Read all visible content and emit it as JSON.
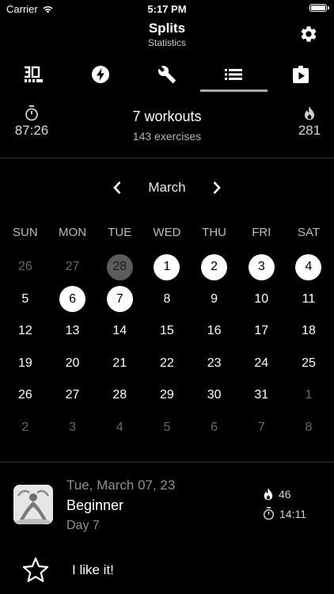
{
  "status_bar": {
    "carrier": "Carrier",
    "time": "5:17 PM"
  },
  "nav": {
    "title": "Splits",
    "subtitle": "Statistics"
  },
  "tabs": [
    {
      "icon": "timer-30-icon"
    },
    {
      "icon": "lightning-icon"
    },
    {
      "icon": "wrench-icon"
    },
    {
      "icon": "list-icon",
      "active": true
    },
    {
      "icon": "clipboard-play-icon"
    }
  ],
  "summary": {
    "duration": "87:26",
    "workouts": "7 workouts",
    "exercises": "143 exercises",
    "calories": "281"
  },
  "calendar": {
    "month": "March",
    "weekdays": [
      "SUN",
      "MON",
      "TUE",
      "WED",
      "THU",
      "FRI",
      "SAT"
    ],
    "days": [
      {
        "n": "26",
        "s": "muted"
      },
      {
        "n": "27",
        "s": "muted"
      },
      {
        "n": "28",
        "s": "gray"
      },
      {
        "n": "1",
        "s": "done"
      },
      {
        "n": "2",
        "s": "done"
      },
      {
        "n": "3",
        "s": "done"
      },
      {
        "n": "4",
        "s": "done"
      },
      {
        "n": "5",
        "s": ""
      },
      {
        "n": "6",
        "s": "done"
      },
      {
        "n": "7",
        "s": "done"
      },
      {
        "n": "8",
        "s": ""
      },
      {
        "n": "9",
        "s": ""
      },
      {
        "n": "10",
        "s": ""
      },
      {
        "n": "11",
        "s": ""
      },
      {
        "n": "12",
        "s": ""
      },
      {
        "n": "13",
        "s": ""
      },
      {
        "n": "14",
        "s": ""
      },
      {
        "n": "15",
        "s": ""
      },
      {
        "n": "16",
        "s": ""
      },
      {
        "n": "17",
        "s": ""
      },
      {
        "n": "18",
        "s": ""
      },
      {
        "n": "19",
        "s": ""
      },
      {
        "n": "20",
        "s": ""
      },
      {
        "n": "21",
        "s": ""
      },
      {
        "n": "22",
        "s": ""
      },
      {
        "n": "23",
        "s": ""
      },
      {
        "n": "24",
        "s": ""
      },
      {
        "n": "25",
        "s": ""
      },
      {
        "n": "26",
        "s": ""
      },
      {
        "n": "27",
        "s": ""
      },
      {
        "n": "28",
        "s": ""
      },
      {
        "n": "29",
        "s": ""
      },
      {
        "n": "30",
        "s": ""
      },
      {
        "n": "31",
        "s": ""
      },
      {
        "n": "1",
        "s": "muted"
      },
      {
        "n": "2",
        "s": "muted"
      },
      {
        "n": "3",
        "s": "muted"
      },
      {
        "n": "4",
        "s": "muted"
      },
      {
        "n": "5",
        "s": "muted"
      },
      {
        "n": "6",
        "s": "muted"
      },
      {
        "n": "7",
        "s": "muted"
      },
      {
        "n": "8",
        "s": "muted"
      }
    ]
  },
  "workout": {
    "date": "Tue, March 07, 23",
    "name": "Beginner",
    "day": "Day 7",
    "calories": "46",
    "duration": "14:11"
  },
  "like": {
    "label": "I like it!"
  },
  "colors": {
    "background": "#000000",
    "done_circle": "#ffffff",
    "past_circle": "#5c5c5c",
    "muted_text": "#6a6a6a"
  }
}
